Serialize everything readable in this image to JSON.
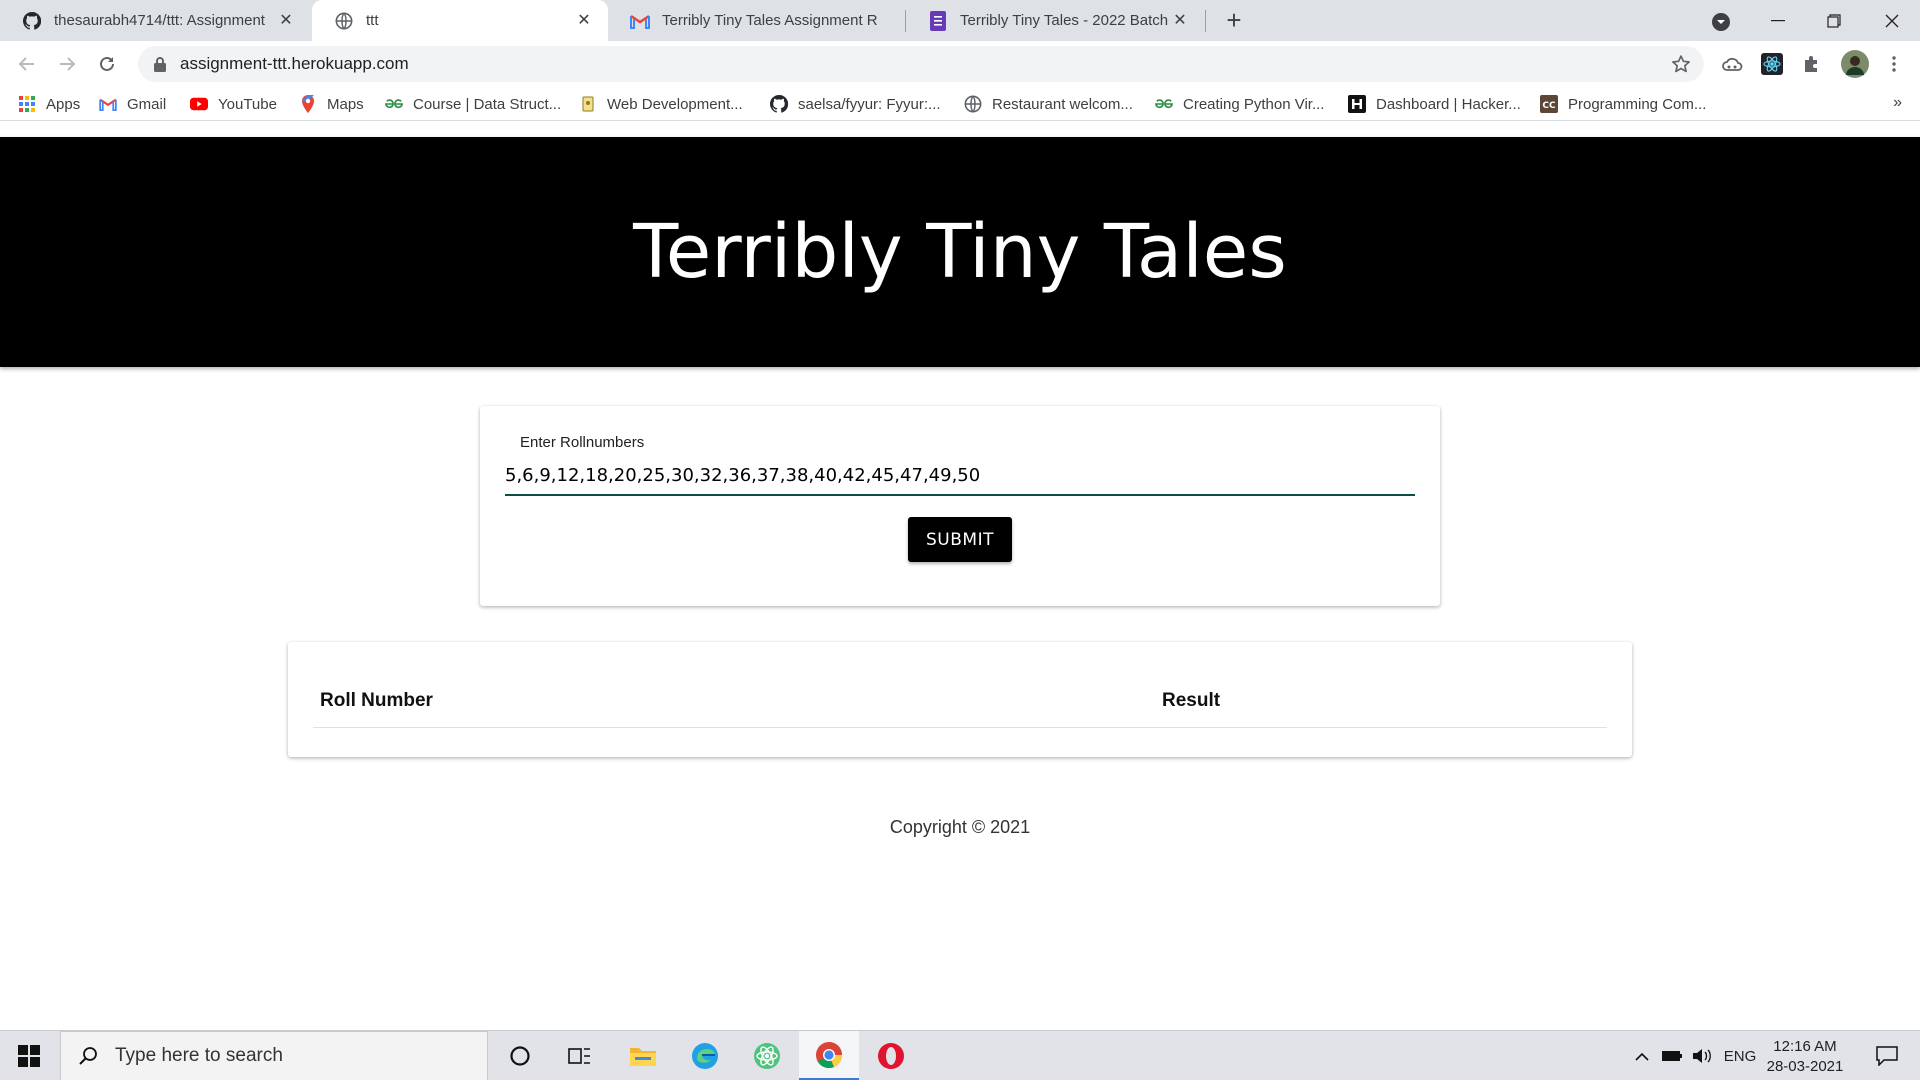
{
  "browser": {
    "tabs": [
      {
        "title": "thesaurabh4714/ttt: Assignment",
        "icon": "github-icon",
        "active": false
      },
      {
        "title": "ttt",
        "icon": "globe-icon",
        "active": true
      },
      {
        "title": "Terribly Tiny Tales Assignment Ro",
        "icon": "gmail-icon",
        "active": false
      },
      {
        "title": "Terribly Tiny Tales - 2022 Batch",
        "icon": "forms-icon",
        "active": false
      }
    ],
    "close_glyph": "✕",
    "new_tab_glyph": "+",
    "url": "assignment-ttt.herokuapp.com"
  },
  "bookmarks": [
    {
      "label": "Apps",
      "icon": "apps-grid-icon"
    },
    {
      "label": "Gmail",
      "icon": "gmail-icon"
    },
    {
      "label": "YouTube",
      "icon": "youtube-icon"
    },
    {
      "label": "Maps",
      "icon": "maps-icon"
    },
    {
      "label": "Course | Data Struct...",
      "icon": "gfg-icon"
    },
    {
      "label": "Web Development...",
      "icon": "bookmark-icon"
    },
    {
      "label": "saelsa/fyyur: Fyyur:...",
      "icon": "github-icon"
    },
    {
      "label": "Restaurant welcom...",
      "icon": "globe-icon"
    },
    {
      "label": "Creating Python Vir...",
      "icon": "gfg-icon"
    },
    {
      "label": "Dashboard | Hacker...",
      "icon": "hackerrank-icon"
    },
    {
      "label": "Programming Com...",
      "icon": "codechef-icon"
    }
  ],
  "bookmarks_more": "»",
  "page": {
    "header_title": "Terribly Tiny Tales",
    "form": {
      "label": "Enter Rollnumbers",
      "value": "5,6,9,12,18,20,25,30,32,36,37,38,40,42,45,47,49,50",
      "submit_label": "SUBMIT"
    },
    "table": {
      "columns": [
        "Roll Number",
        "Result"
      ],
      "rows": []
    },
    "footer": "Copyright © 2021"
  },
  "taskbar": {
    "search_placeholder": "Type here to search",
    "language": "ENG",
    "time": "12:16 AM",
    "date": "28-03-2021"
  },
  "colors": {
    "header_bg": "#000000",
    "input_underline": "#0b4f4a",
    "button_bg": "#000000"
  }
}
